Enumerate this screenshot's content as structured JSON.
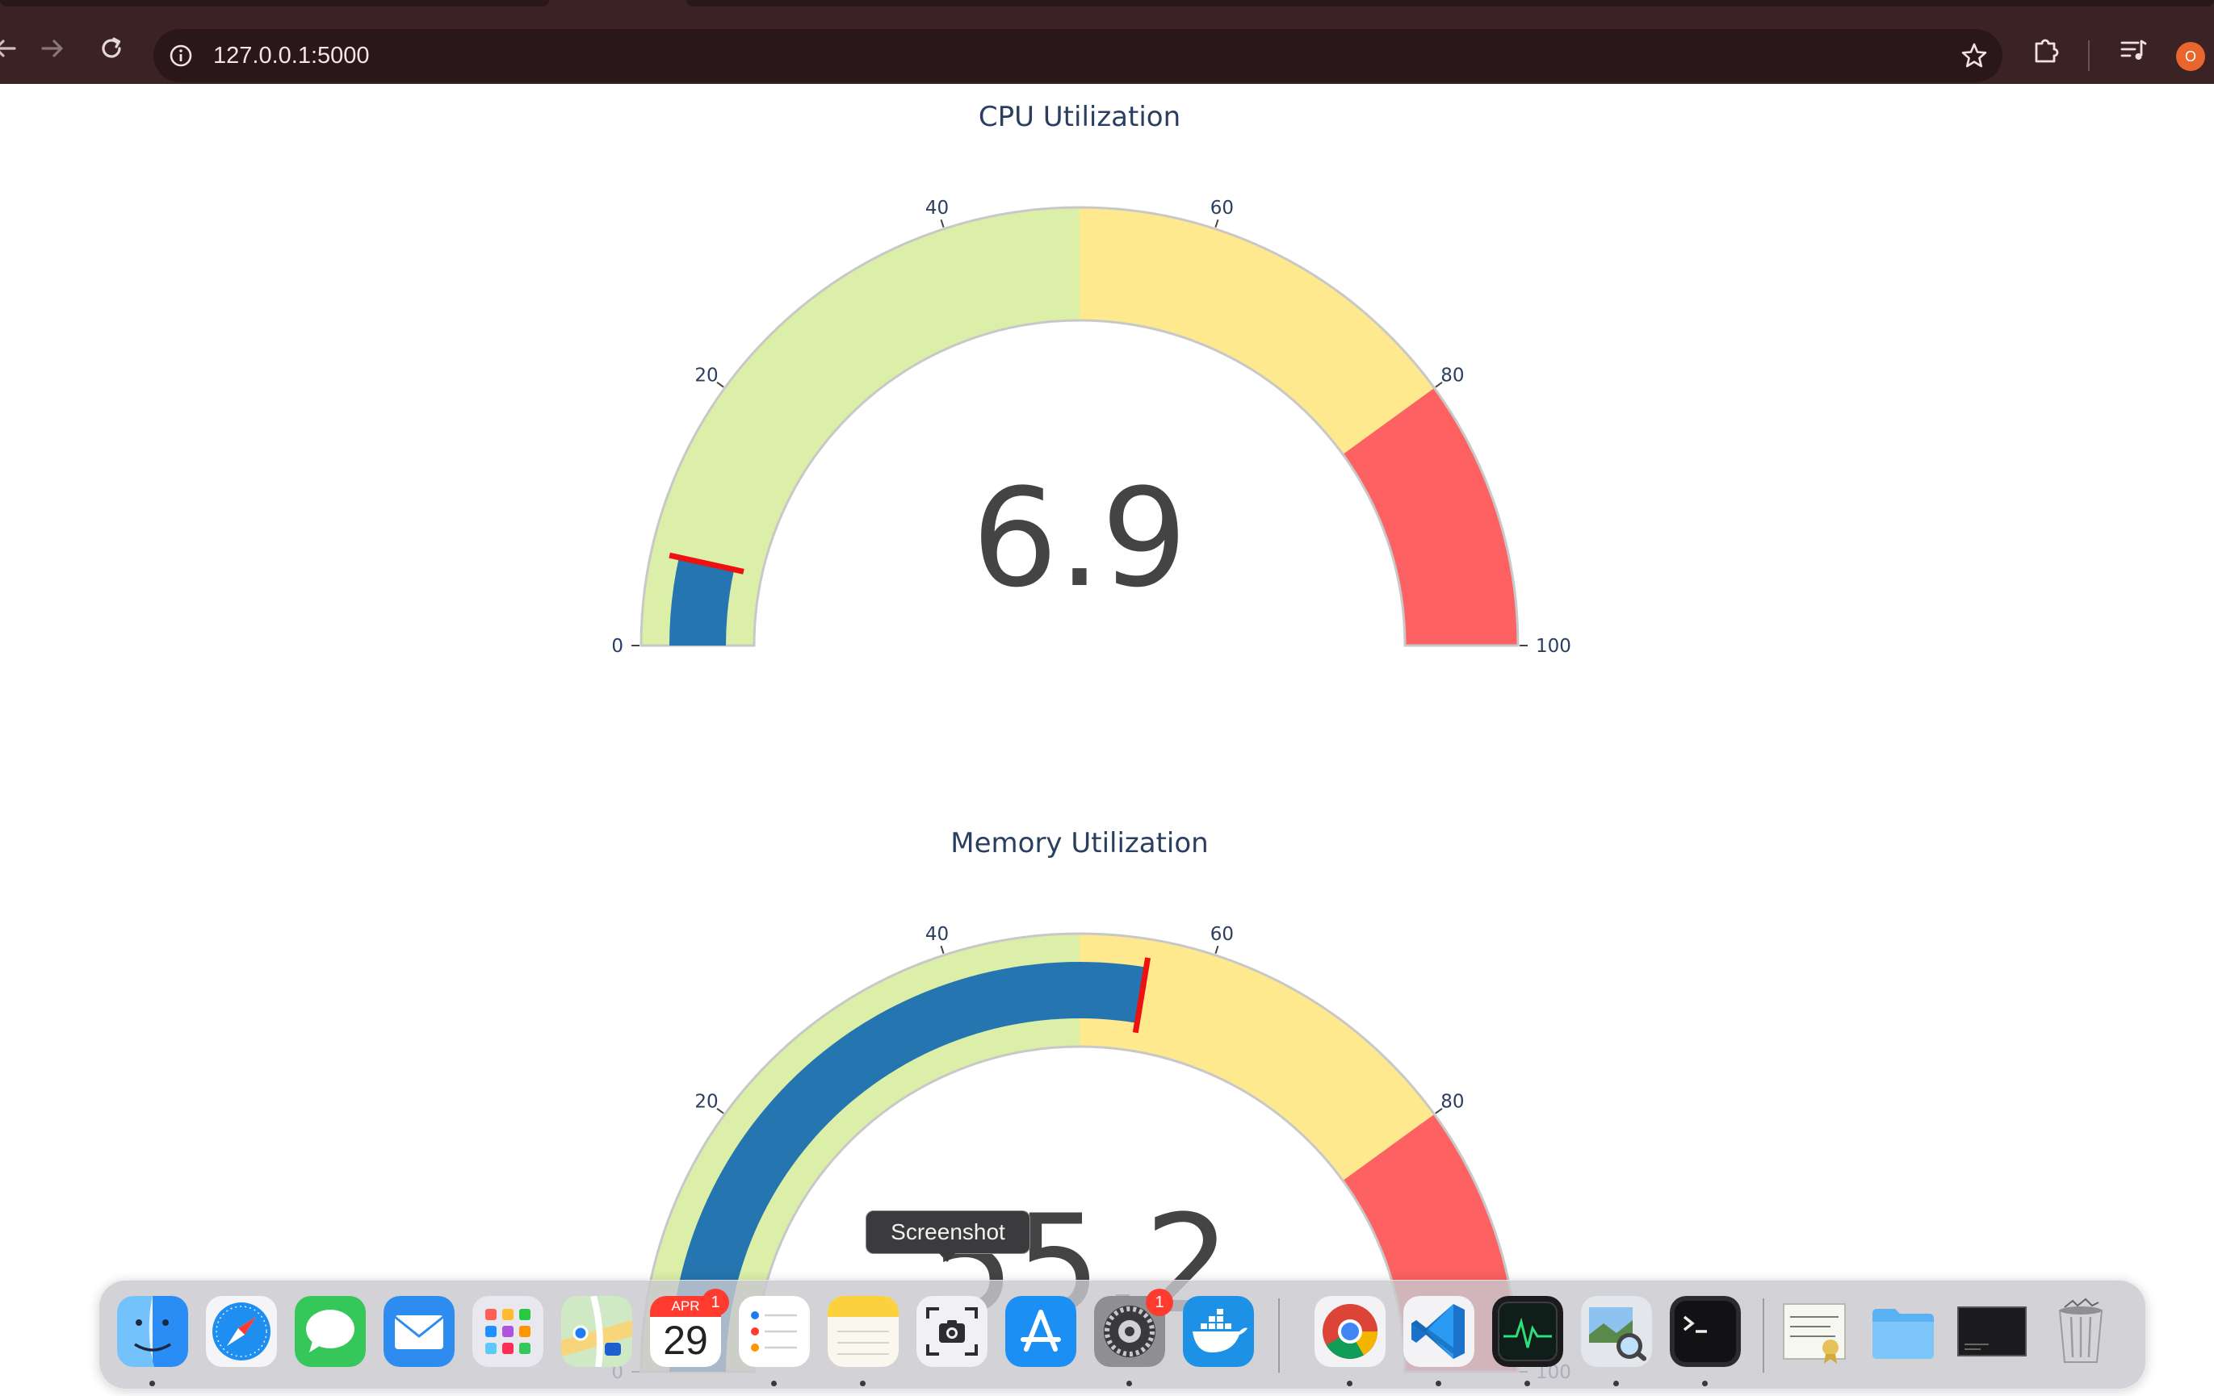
{
  "browser": {
    "url": "127.0.0.1:5000",
    "profile_initial": "O",
    "icons": [
      "back-arrow-icon",
      "forward-arrow-icon",
      "reload-icon",
      "site-info-icon",
      "bookmark-star-icon",
      "extensions-icon",
      "media-queue-icon"
    ]
  },
  "gauges": [
    {
      "title": "CPU Utilization",
      "value": 6.9,
      "value_label": "6.9",
      "range": [
        0,
        100
      ],
      "tick_labels": [
        "0",
        "20",
        "40",
        "60",
        "80",
        "100"
      ],
      "steps": [
        {
          "range": [
            0,
            50
          ],
          "color": "#dbefa8"
        },
        {
          "range": [
            50,
            80
          ],
          "color": "#fee98f"
        },
        {
          "range": [
            80,
            100
          ],
          "color": "#fd6161"
        }
      ],
      "bar_color": "#2575b0",
      "threshold": {
        "value": 6.9,
        "color": "#ee1111"
      }
    },
    {
      "title": "Memory Utilization",
      "value": 55.2,
      "value_label": "55.2",
      "range": [
        0,
        100
      ],
      "tick_labels": [
        "0",
        "20",
        "40",
        "60",
        "80",
        "100"
      ],
      "steps": [
        {
          "range": [
            0,
            50
          ],
          "color": "#dbefa8"
        },
        {
          "range": [
            50,
            80
          ],
          "color": "#fee98f"
        },
        {
          "range": [
            80,
            100
          ],
          "color": "#fd6161"
        }
      ],
      "bar_color": "#2575b0",
      "threshold": {
        "value": 55.2,
        "color": "#ee1111"
      }
    }
  ],
  "dock": {
    "tooltip": "Screenshot",
    "calendar": {
      "month": "APR",
      "day": "29"
    },
    "items": [
      {
        "name": "finder-icon",
        "running": true
      },
      {
        "name": "safari-icon",
        "running": false
      },
      {
        "name": "messages-icon",
        "running": false
      },
      {
        "name": "mail-icon",
        "running": false
      },
      {
        "name": "launchpad-icon",
        "running": false
      },
      {
        "name": "maps-icon",
        "running": false
      },
      {
        "name": "calendar-icon",
        "running": false,
        "badge": "1"
      },
      {
        "name": "reminders-icon",
        "running": true
      },
      {
        "name": "notes-icon",
        "running": true
      },
      {
        "name": "screenshot-icon",
        "running": false
      },
      {
        "name": "app-store-icon",
        "running": false
      },
      {
        "name": "system-settings-icon",
        "running": true,
        "badge": "1"
      },
      {
        "name": "docker-icon",
        "running": false
      },
      {
        "name": "chrome-icon",
        "running": true
      },
      {
        "name": "vscode-icon",
        "running": true
      },
      {
        "name": "activity-monitor-icon",
        "running": true
      },
      {
        "name": "preview-icon",
        "running": true
      },
      {
        "name": "terminal-icon",
        "running": true
      },
      {
        "name": "certificate-file-icon",
        "running": false
      },
      {
        "name": "folder-icon",
        "running": false
      },
      {
        "name": "screen-recording-thumbnail-icon",
        "running": false
      },
      {
        "name": "trash-icon",
        "running": false
      }
    ]
  }
}
